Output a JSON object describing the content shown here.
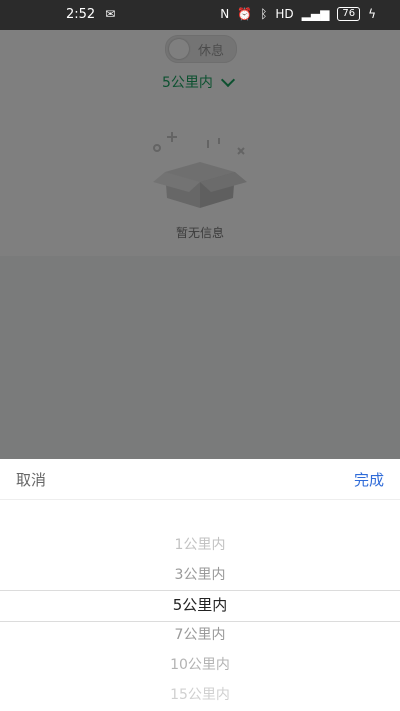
{
  "status_bar": {
    "time": "2:52",
    "battery": "76",
    "icons": [
      "wechat-icon",
      "nfc-icon",
      "alarm-icon",
      "bluetooth-icon",
      "hd-icon",
      "signal-icon",
      "battery-icon",
      "charging-icon"
    ]
  },
  "header": {
    "rest_toggle_label": "休息",
    "distance_selected": "5公里内"
  },
  "empty_state": {
    "message": "暂无信息"
  },
  "picker": {
    "cancel_label": "取消",
    "done_label": "完成",
    "options": [
      "1公里内",
      "3公里内",
      "5公里内",
      "7公里内",
      "10公里内",
      "15公里内"
    ],
    "selected_index": 2
  },
  "colors": {
    "accent_green": "#1aa260",
    "done_blue": "#2f6bd8"
  }
}
